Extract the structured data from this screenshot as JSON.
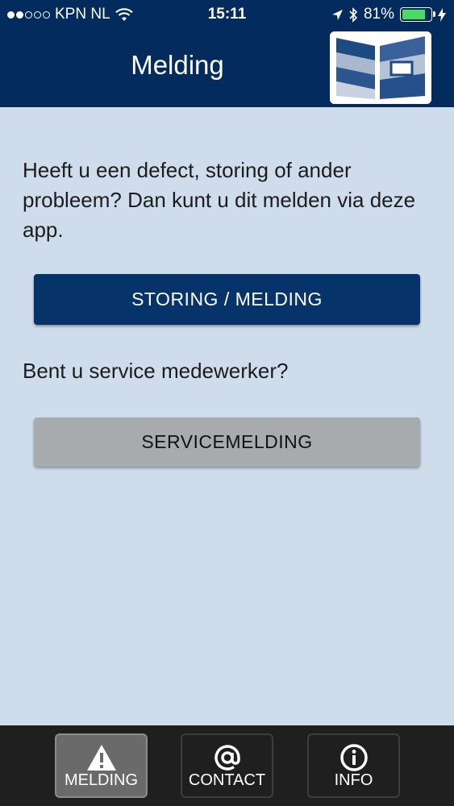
{
  "status_bar": {
    "carrier": "KPN NL",
    "time": "15:11",
    "battery_percent": "81%",
    "battery_level": 0.81,
    "signal_strength": 2
  },
  "header": {
    "title": "Melding"
  },
  "main": {
    "intro_text": "Heeft u een defect, storing of ander probleem? Dan kunt u dit melden via deze app.",
    "primary_button_label": "STORING / MELDING",
    "service_question": "Bent u service medewerker?",
    "secondary_button_label": "SERVICEMELDING"
  },
  "tabbar": {
    "tabs": [
      {
        "label": "MELDING",
        "icon": "warning-icon",
        "active": true
      },
      {
        "label": "CONTACT",
        "icon": "at-sign-icon",
        "active": false
      },
      {
        "label": "INFO",
        "icon": "info-icon",
        "active": false
      }
    ]
  },
  "colors": {
    "header_bg": "#032b5e",
    "content_bg": "#cfdcec",
    "primary_button": "#05336a",
    "secondary_button": "#a7abae",
    "tabbar_bg": "#1f1f1f",
    "battery_fill": "#4cd964"
  }
}
